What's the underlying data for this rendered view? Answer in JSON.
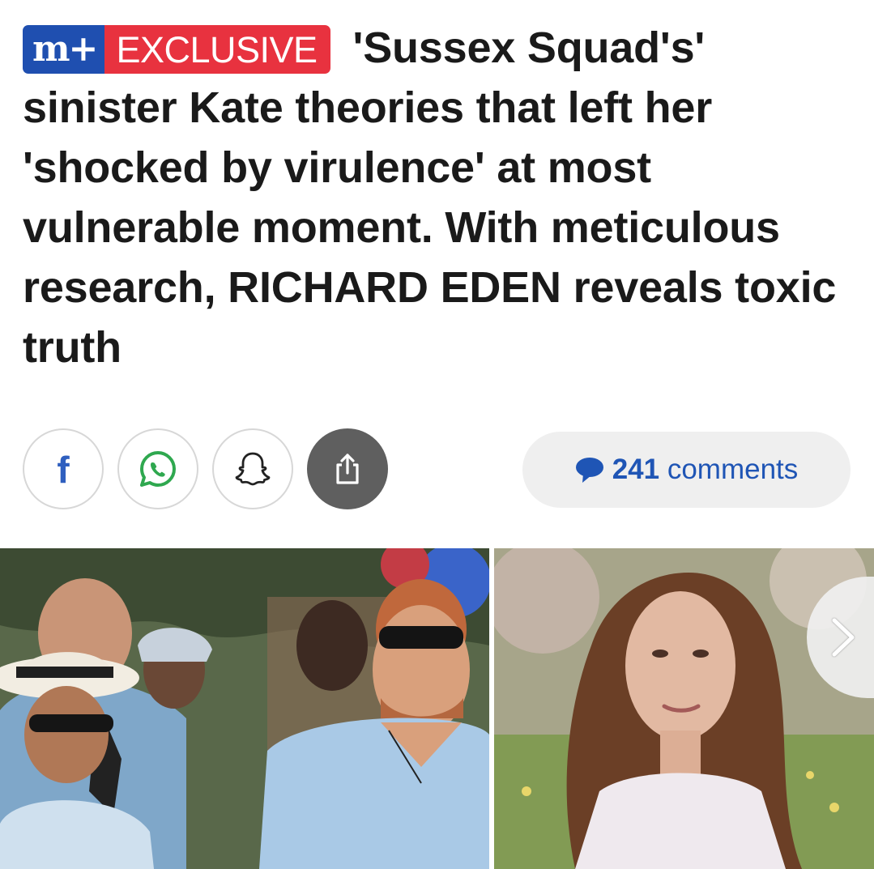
{
  "article": {
    "badge": {
      "brand_label": "m+",
      "tag_label": "EXCLUSIVE"
    },
    "headline": "'Sussex Squad's' sinister Kate theories that left her 'shocked by virulence' at most vulnerable moment. With meticulous research, RICHARD EDEN reveals toxic truth"
  },
  "share": {
    "facebook_glyph": "f",
    "buttons": [
      {
        "icon": "facebook-icon"
      },
      {
        "icon": "whatsapp-icon"
      },
      {
        "icon": "snapchat-icon"
      },
      {
        "icon": "share-icon"
      }
    ]
  },
  "comments": {
    "count": "241",
    "label": "comments",
    "icon": "speech-bubble-icon"
  },
  "gallery": {
    "next_icon": "chevron-right-icon"
  },
  "colors": {
    "brand_blue": "#1f4fb0",
    "exclusive_red": "#e8323f",
    "comments_blue": "#1f55b5",
    "facebook_blue": "#2f5fbf",
    "whatsapp_green": "#2fa84f"
  }
}
